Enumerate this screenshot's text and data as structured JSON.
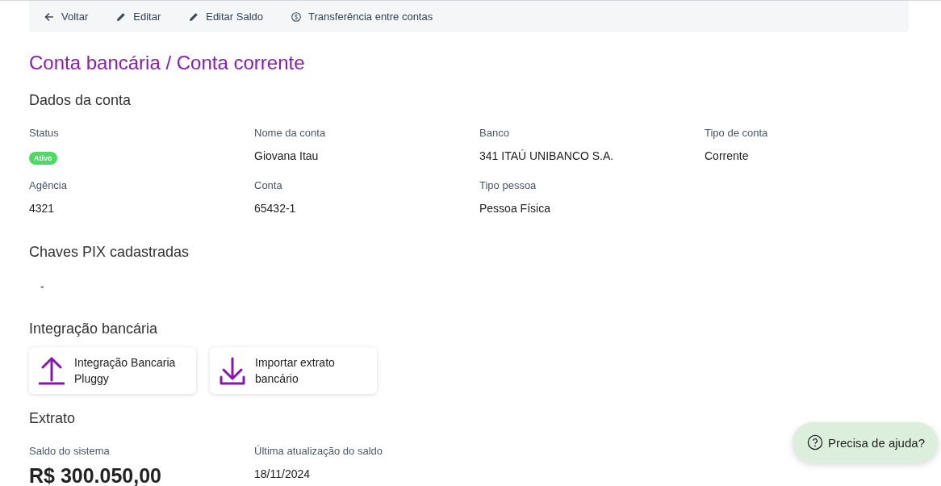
{
  "toolbar": [
    {
      "label": "Voltar",
      "kind": "back"
    },
    {
      "label": "Editar",
      "kind": "edit"
    },
    {
      "label": "Editar Saldo",
      "kind": "edit"
    },
    {
      "label": "Transferência entre contas",
      "kind": "money"
    }
  ],
  "title": "Conta bancária / Conta corrente",
  "account": {
    "heading": "Dados da conta",
    "fields": [
      {
        "label": "Status",
        "value": "Ativo",
        "kind": "badge"
      },
      {
        "label": "Nome da conta",
        "value": "Giovana Itau",
        "kind": "text"
      },
      {
        "label": "Banco",
        "value": "341 ITAÚ UNIBANCO S.A.",
        "kind": "text"
      },
      {
        "label": "Tipo de conta",
        "value": "Corrente",
        "kind": "text"
      },
      {
        "label": "Agência",
        "value": "4321",
        "kind": "text"
      },
      {
        "label": "Conta",
        "value": "65432-1",
        "kind": "text"
      },
      {
        "label": "Tipo pessoa",
        "value": "Pessoa Física",
        "kind": "text"
      }
    ]
  },
  "pix": {
    "heading": "Chaves PIX cadastradas",
    "value": "-"
  },
  "integration": {
    "heading": "Integração bancária",
    "cards": [
      {
        "label": "Integração Bancaria Pluggy",
        "kind": "upload"
      },
      {
        "label": "Importar extrato bancário",
        "kind": "download"
      }
    ]
  },
  "statement": {
    "heading": "Extrato",
    "balance_label": "Saldo do sistema",
    "balance": "R$ 300.050,00",
    "updated_label": "Última atualização do saldo",
    "updated": "18/11/2024"
  },
  "help_button": {
    "label": "Precisa de ajuda?"
  }
}
